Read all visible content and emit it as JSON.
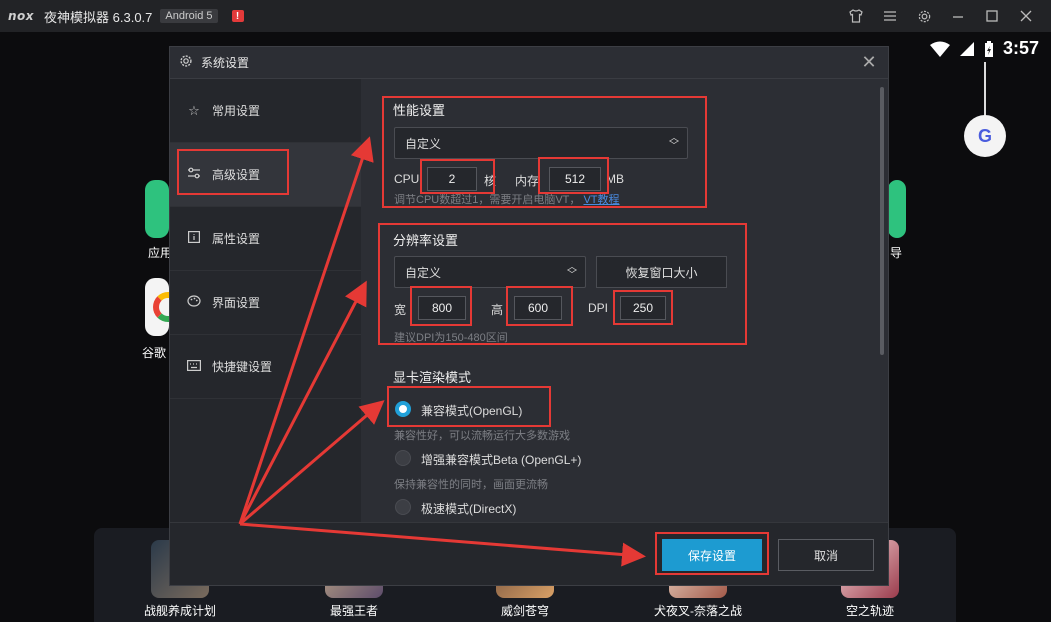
{
  "titlebar": {
    "logo": "nox",
    "title": "夜神模拟器 6.3.0.7",
    "android_badge": "Android 5",
    "alert": "!",
    "icons": [
      "shirt-icon",
      "menu-icon",
      "gear-icon",
      "minimize-icon",
      "maximize-icon",
      "close-icon"
    ]
  },
  "statusbar": {
    "time": "3:57"
  },
  "desktop": {
    "left_label_1": "应用",
    "left_label_2": "谷歌",
    "right_label": "导",
    "bubble": "G"
  },
  "dock": {
    "games": [
      {
        "name": "战舰养成计划"
      },
      {
        "name": "最强王者"
      },
      {
        "name": "威剑苍穹"
      },
      {
        "name": "犬夜叉-奈落之战"
      },
      {
        "name": "空之轨迹"
      }
    ]
  },
  "dialog": {
    "title": "系统设置",
    "close": "✕",
    "sidebar": [
      {
        "label": "常用设置",
        "icon": "star-icon"
      },
      {
        "label": "高级设置",
        "icon": "sliders-icon",
        "active": true
      },
      {
        "label": "属性设置",
        "icon": "info-icon"
      },
      {
        "label": "界面设置",
        "icon": "palette-icon"
      },
      {
        "label": "快捷键设置",
        "icon": "keyboard-icon"
      }
    ],
    "performance": {
      "title": "性能设置",
      "mode": "自定义",
      "cpu_label": "CPU",
      "cpu_value": "2",
      "cpu_unit": "核",
      "mem_label": "内存",
      "mem_value": "512",
      "mem_unit": "MB",
      "hint": "调节CPU数超过1，需要开启电脑VT，",
      "hint_link": "VT教程"
    },
    "resolution": {
      "title": "分辨率设置",
      "mode": "自定义",
      "restore_button": "恢复窗口大小",
      "width_label": "宽",
      "width_value": "800",
      "height_label": "高",
      "height_value": "600",
      "dpi_label": "DPI",
      "dpi_value": "250",
      "hint": "建议DPI为150-480区间"
    },
    "render": {
      "title": "显卡渲染模式",
      "options": [
        {
          "label": "兼容模式(OpenGL)",
          "hint": "兼容性好，可以流畅运行大多数游戏",
          "selected": true
        },
        {
          "label": "增强兼容模式Beta (OpenGL+)",
          "hint": "保持兼容性的同时，画面更流畅",
          "selected": false
        },
        {
          "label": "极速模式(DirectX)",
          "selected": false
        }
      ]
    },
    "footer": {
      "save": "保存设置",
      "cancel": "取消"
    }
  },
  "colors": {
    "accent": "#1d9bd1",
    "annotation": "#e53935",
    "dialog_bg": "#2c2e34",
    "sidebar_bg": "#25272c"
  }
}
